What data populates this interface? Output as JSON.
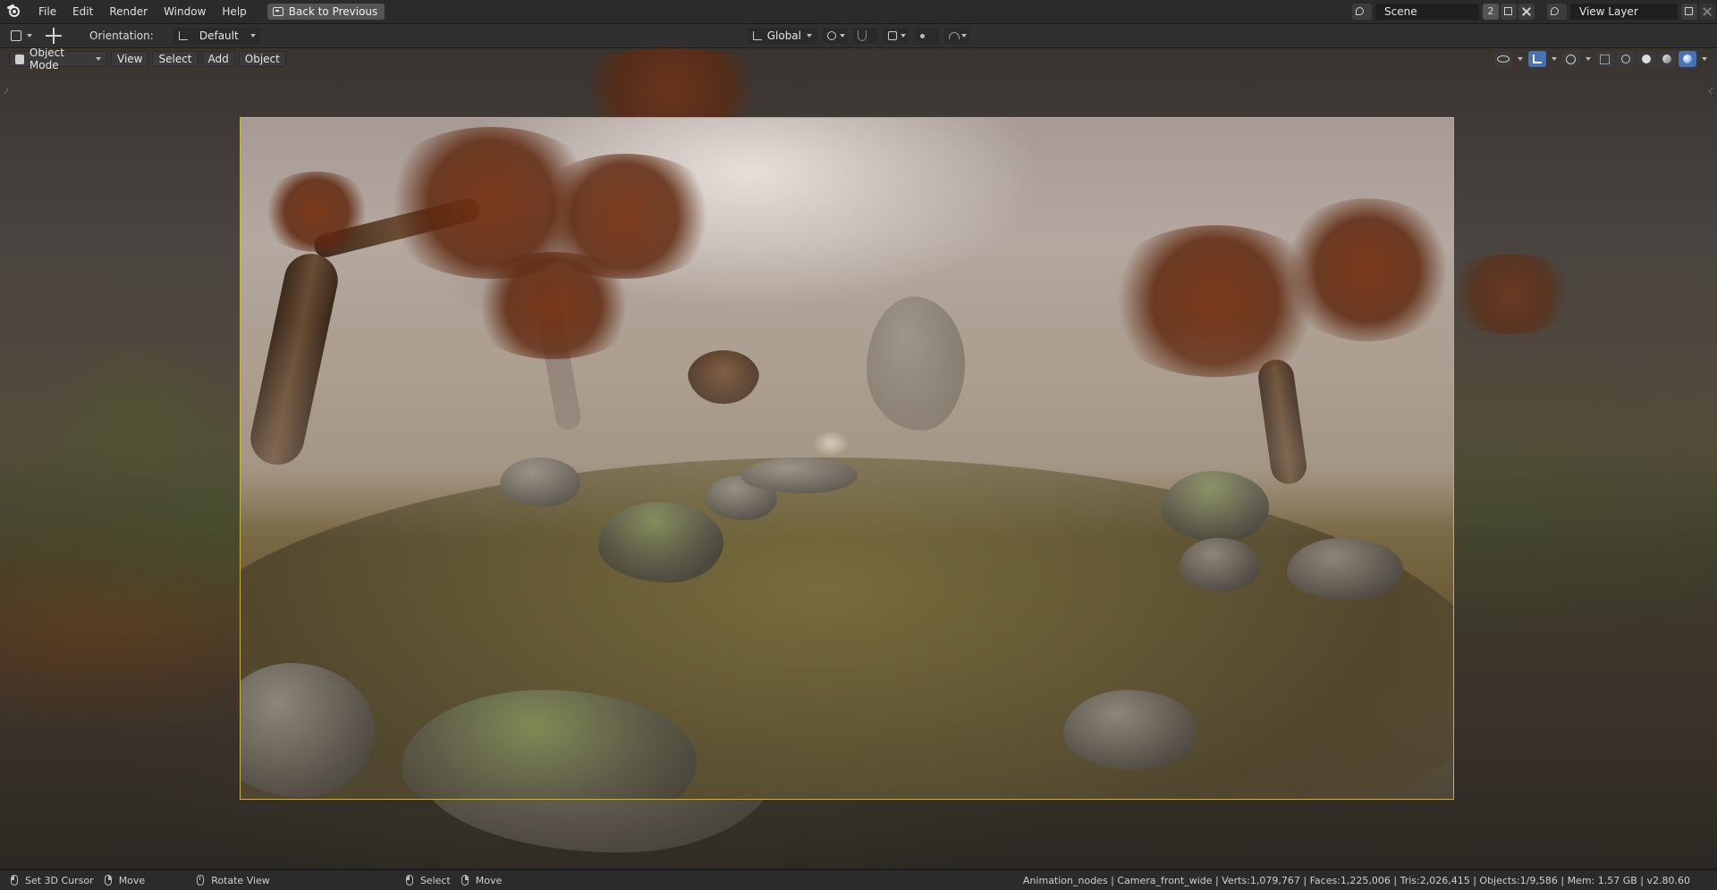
{
  "menu": {
    "items": [
      "File",
      "Edit",
      "Render",
      "Window",
      "Help"
    ],
    "back_button": "Back to Previous"
  },
  "scene": {
    "name": "Scene",
    "users": "2",
    "view_layer": "View Layer"
  },
  "toolbar": {
    "orientation_label": "Orientation:",
    "orientation_value": "Default",
    "transform_orientation": "Global"
  },
  "viewport": {
    "mode": "Object Mode",
    "header_menus": [
      "View",
      "Select",
      "Add",
      "Object"
    ],
    "shading_active": "rendered",
    "camera_frame_color": "#c9b04a"
  },
  "status": {
    "hints": [
      {
        "mouse": "left",
        "label": "Set 3D Cursor"
      },
      {
        "mouse": "right",
        "label": "Move"
      },
      {
        "mouse": "mid",
        "label": "Rotate View"
      },
      {
        "mouse": "left",
        "label": "Select"
      },
      {
        "mouse": "right",
        "label": "Move"
      }
    ],
    "stats": "Animation_nodes | Camera_front_wide | Verts:1,079,767 | Faces:1,225,006 | Tris:2,026,415 | Objects:1/9,586 | Mem: 1.57 GB | v2.80.60"
  },
  "colors": {
    "accent": "#4772b3",
    "camera_frame": "#c9b04a"
  }
}
